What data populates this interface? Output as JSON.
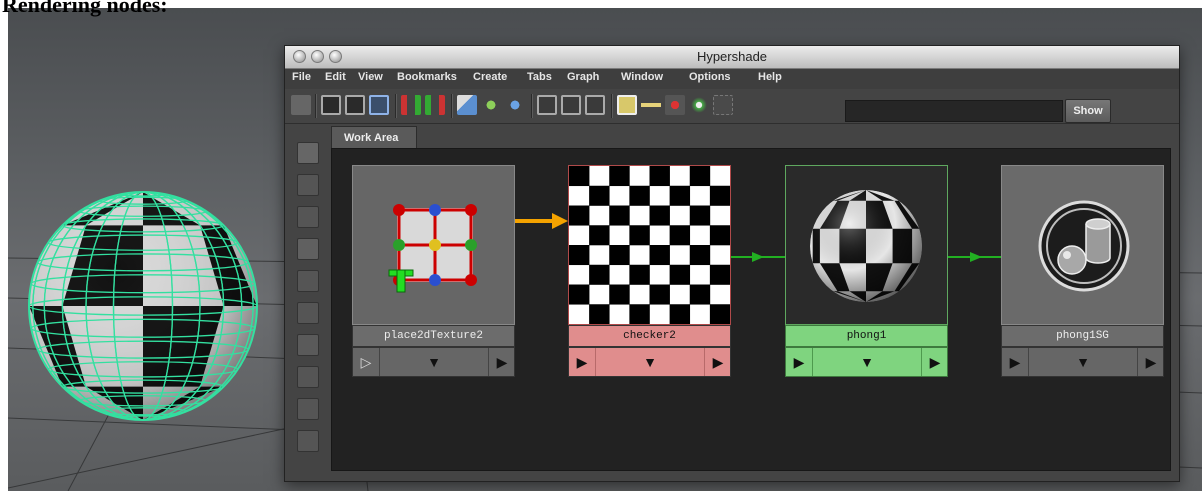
{
  "caption": "Rendering nodes:",
  "window": {
    "title": "Hypershade"
  },
  "menu": [
    "File",
    "Edit",
    "View",
    "Bookmarks",
    "Create",
    "Tabs",
    "Graph",
    "Window",
    "Options",
    "Help"
  ],
  "toolbar": {
    "show_label": "Show",
    "filter_value": "",
    "buttons": [
      "open-scene-icon",
      "top-tabs-only-icon",
      "bottom-tabs-only-icon",
      "top-and-bottom-tabs-icon",
      "graph-upstream-icon",
      "graph-downstream-icon",
      "clear-graph-icon",
      "rearrange-graph-icon",
      "add-selected-icon",
      "remove-selected-icon",
      "previous-graph-icon",
      "next-graph-icon",
      "render-swatch-icon",
      "show-attributes-icon",
      "select-nodes-icon",
      "select-input-icon",
      "select-output-icon"
    ]
  },
  "tabs": [
    {
      "label": "Work Area"
    }
  ],
  "colors": {
    "selected_node": "#7fd47f",
    "selected_border": "#5fa85f",
    "texture_node": "#e08d8d",
    "connection_input": "#f5a300",
    "connection_output": "#22b022",
    "wireframe": "#33e0a0",
    "workarea_bg": "#222222"
  },
  "nodes": [
    {
      "name": "place2dTexture2",
      "type": "place2dTexture",
      "swatch": "placement-grid-icon",
      "input_arrow": "▷",
      "mid_arrow": "▼",
      "output_arrow": "▶",
      "state": "normal"
    },
    {
      "name": "checker2",
      "type": "checker",
      "swatch": "checker-texture",
      "input_arrow": "▶",
      "mid_arrow": "▼",
      "output_arrow": "▶",
      "state": "texture"
    },
    {
      "name": "phong1",
      "type": "phong",
      "swatch": "checker-sphere",
      "input_arrow": "▶",
      "mid_arrow": "▼",
      "output_arrow": "▶",
      "state": "selected"
    },
    {
      "name": "phong1SG",
      "type": "shadingEngine",
      "swatch": "shading-group-icon",
      "input_arrow": "▶",
      "mid_arrow": "▼",
      "output_arrow": "▶",
      "state": "normal"
    }
  ],
  "connections": [
    {
      "from": "place2dTexture2",
      "to": "checker2",
      "color": "#f5a300"
    },
    {
      "from": "checker2",
      "to": "phong1",
      "color": "#22b022"
    },
    {
      "from": "phong1",
      "to": "phong1SG",
      "color": "#22b022"
    }
  ]
}
